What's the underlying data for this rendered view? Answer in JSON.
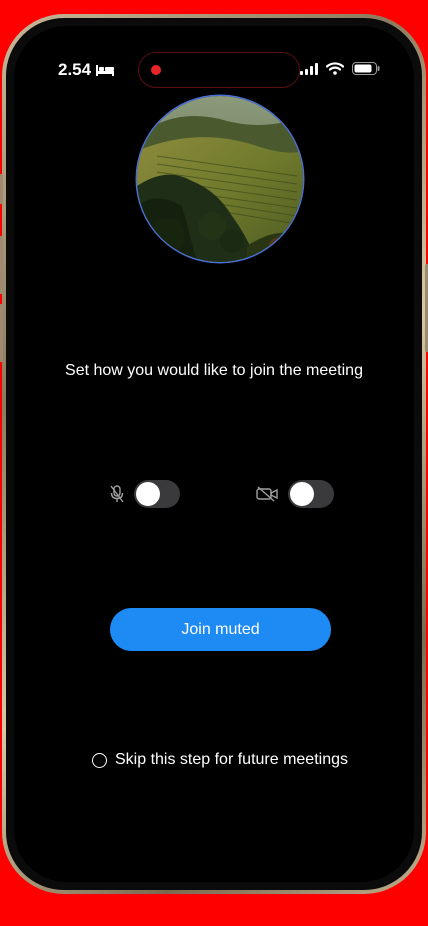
{
  "status_bar": {
    "time": "2.54",
    "icons": [
      "bed-icon",
      "recording-dot-icon",
      "signal-icon",
      "wifi-icon",
      "battery-icon"
    ]
  },
  "meeting": {
    "prompt": "Set how you would like to join the meeting",
    "microphone_toggle": {
      "icon": "mic-off-icon",
      "on": false
    },
    "camera_toggle": {
      "icon": "camera-off-icon",
      "on": false
    },
    "join_button_label": "Join muted",
    "skip_label": "Skip this step for future meetings",
    "skip_checked": false
  },
  "colors": {
    "accent": "#1e8bf5",
    "recording": "#e8262a",
    "outer_background": "#ff0000"
  }
}
